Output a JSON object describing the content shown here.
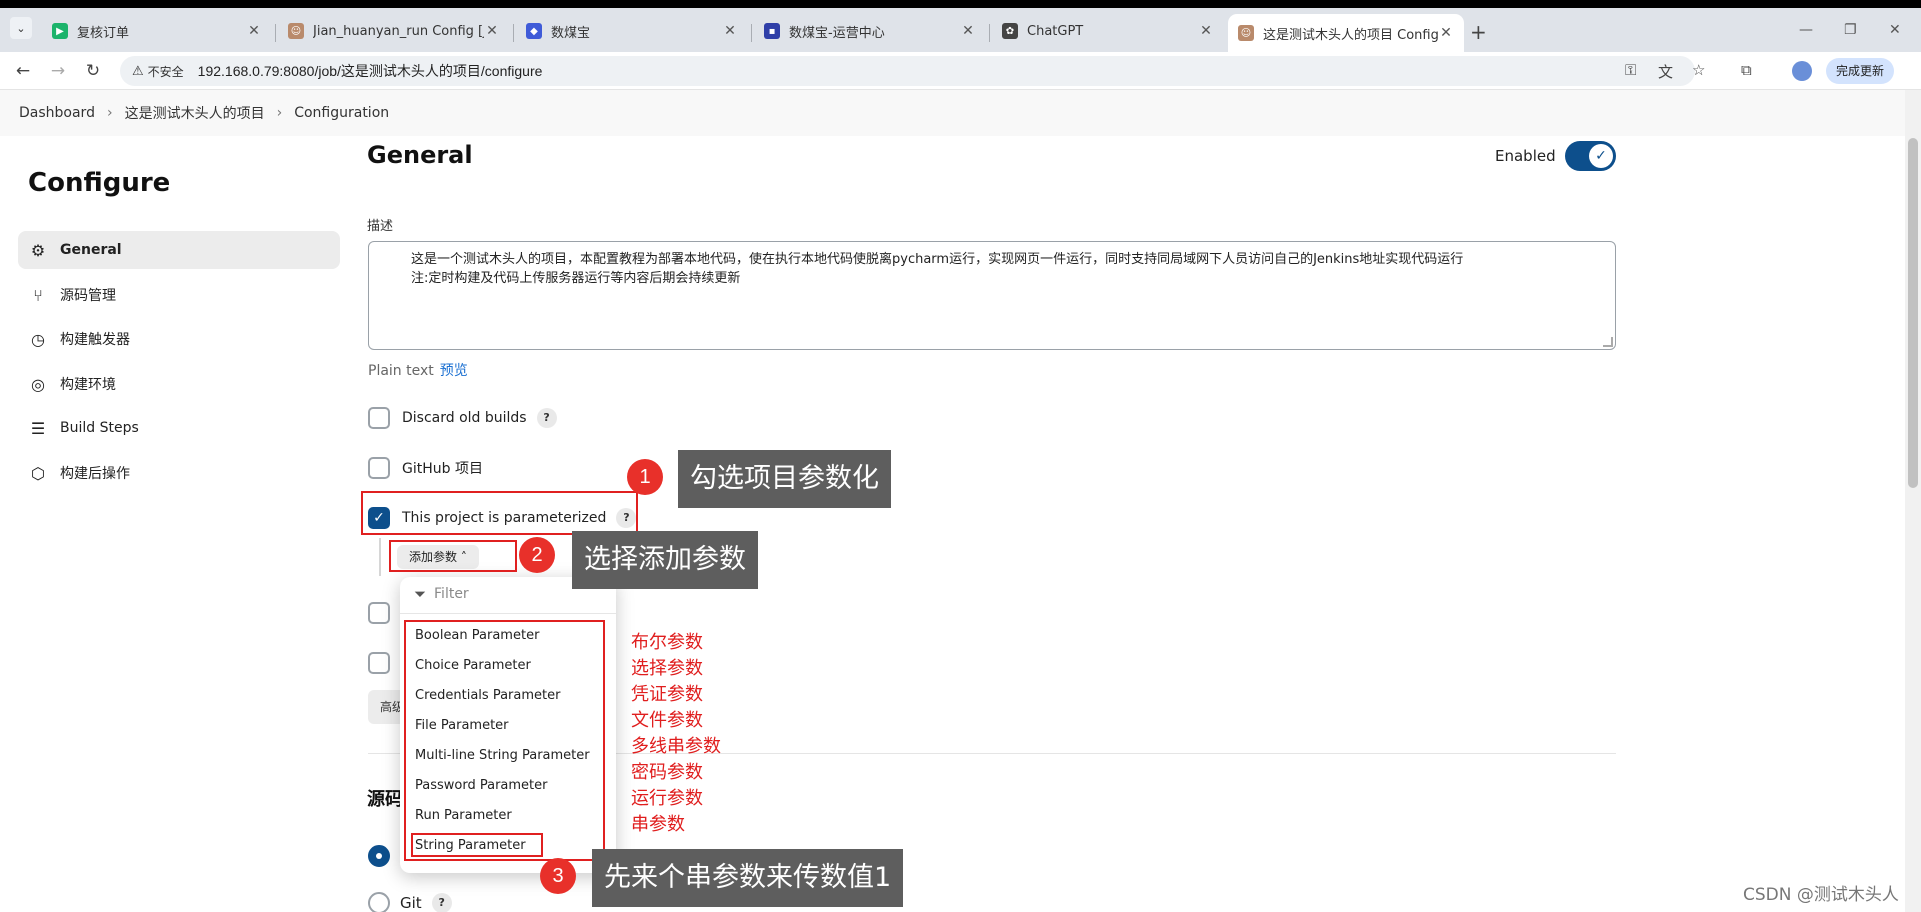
{
  "browser": {
    "tabs": [
      {
        "title": "复核订单",
        "favicon_color": "#1cb36b"
      },
      {
        "title": "Jian_huanyan_run Config [Jen",
        "favicon_color": "#b98a6b"
      },
      {
        "title": "数煤宝",
        "favicon_color": "#3f5bd8"
      },
      {
        "title": "数煤宝-运营中心",
        "favicon_color": "#2f3fa8"
      },
      {
        "title": "ChatGPT",
        "favicon_color": "#444444"
      },
      {
        "title": "这是测试木头人的项目 Config",
        "favicon_color": "#b98a6b"
      }
    ],
    "not_secure_label": "不安全",
    "url": "192.168.0.79:8080/job/这是测试木头人的项目/configure",
    "finish_button": "完成更新"
  },
  "breadcrumb": [
    "Dashboard",
    "这是测试木头人的项目",
    "Configuration"
  ],
  "sidebar": {
    "title": "Configure",
    "items": [
      {
        "label": "General",
        "icon": "gear-icon"
      },
      {
        "label": "源码管理",
        "icon": "branch-icon"
      },
      {
        "label": "构建触发器",
        "icon": "clock-icon"
      },
      {
        "label": "构建环境",
        "icon": "globe-icon"
      },
      {
        "label": "Build Steps",
        "icon": "list-icon"
      },
      {
        "label": "构建后操作",
        "icon": "cube-icon"
      }
    ]
  },
  "main": {
    "section_title": "General",
    "enabled_label": "Enabled",
    "description_label": "描述",
    "description_line1": "这是一个测试木头人的项目，本配置教程为部署本地代码，使在执行本地代码使脱离pycharm运行，实现网页一件运行，同时支持同局域网下人员访问自己的Jenkins地址实现代码运行",
    "description_line2": "注:定时构建及代码上传服务器运行等内容后期会持续更新",
    "plain_text_label": "Plain text",
    "preview_link": "预览",
    "discard_old_builds": "Discard old builds",
    "github_project": "GitHub 项目",
    "parameterized": "This project is parameterized",
    "add_param_button": "添加参数",
    "advanced_chip": "高级",
    "source_section_title": "源码",
    "git_label": "Git",
    "help_glyph": "?"
  },
  "dropdown": {
    "filter_placeholder": "Filter",
    "items": [
      "Boolean Parameter",
      "Choice Parameter",
      "Credentials Parameter",
      "File Parameter",
      "Multi-line String Parameter",
      "Password Parameter",
      "Run Parameter",
      "String Parameter"
    ]
  },
  "annotations": {
    "step1_num": "1",
    "step1_text": "勾选项目参数化",
    "step2_num": "2",
    "step2_text": "选择添加参数",
    "step3_num": "3",
    "step3_text": "先来个串参数来传数值1",
    "cn_names": [
      "布尔参数",
      "选择参数",
      "凭证参数",
      "文件参数",
      "多线串参数",
      "密码参数",
      "运行参数",
      "串参数"
    ],
    "watermark": "CSDN @测试木头人"
  },
  "colors": {
    "accent": "#0d4f8c",
    "annotation_red": "#e02020",
    "callout_gray": "#5e5e5e"
  }
}
